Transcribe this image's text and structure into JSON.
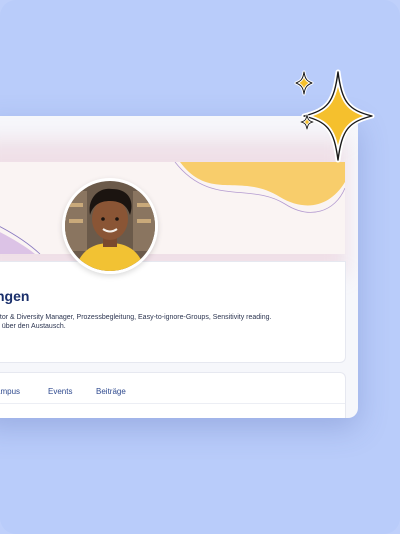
{
  "profile": {
    "name": "ngen",
    "bio_line1": "ator & Diversity Manager, Prozessbegleitung, Easy-to-ignore-Groups, Sensitivity reading.",
    "bio_line2": "h über den Austausch."
  },
  "tabs": [
    {
      "label": "ampus"
    },
    {
      "label": "Events"
    },
    {
      "label": "Beiträge"
    }
  ],
  "colors": {
    "background": "#bfd0fb",
    "banner_wave": "#f8cd6b",
    "name_text": "#1a2f6b",
    "sparkle": "#f5c02d"
  },
  "icons": {
    "sparkle_large": "four-point-star",
    "sparkle_small": "four-point-star"
  }
}
